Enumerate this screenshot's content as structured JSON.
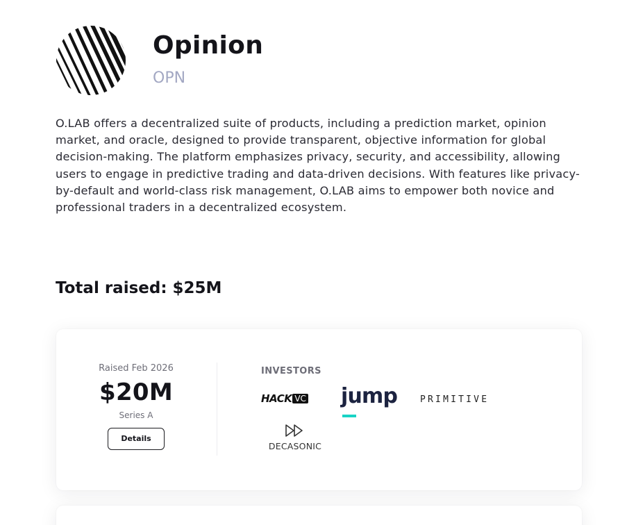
{
  "project": {
    "name": "Opinion",
    "ticker": "OPN",
    "logo_icon": "diagonal-stripes-logo",
    "description": "O.LAB offers a decentralized suite of products, including a prediction market, opinion market, and oracle, designed to provide transparent, objective information for global decision-making. The platform emphasizes privacy, security, and accessibility, allowing users to engage in predictive trading and data-driven decisions. With features like privacy-by-default and world-class risk management, O.LAB aims to empower both novice and professional traders in a decentralized ecosystem."
  },
  "funding": {
    "total_raised": "Total raised: $25M",
    "rounds": [
      {
        "raised_date": "Raised Feb 2026",
        "amount": "$20M",
        "series": "Series A",
        "details_label": "Details",
        "investors_label": "INVESTORS",
        "investors": [
          {
            "name": "hack-vc",
            "logo_text": "HACK",
            "logo_badge": "VC"
          },
          {
            "name": "jump",
            "logo_text": "jump",
            "accent_color": "#19d3c5"
          },
          {
            "name": "primitive",
            "logo_text": "PRIMITIVE"
          },
          {
            "name": "decasonic",
            "logo_text": "DECASONIC"
          }
        ]
      }
    ]
  },
  "colors": {
    "ticker": "#a3a8c3",
    "text_primary": "#14141a",
    "text_muted": "#6e6e78",
    "jump_accent": "#19d3c5",
    "jump_navy": "#1c2340"
  }
}
